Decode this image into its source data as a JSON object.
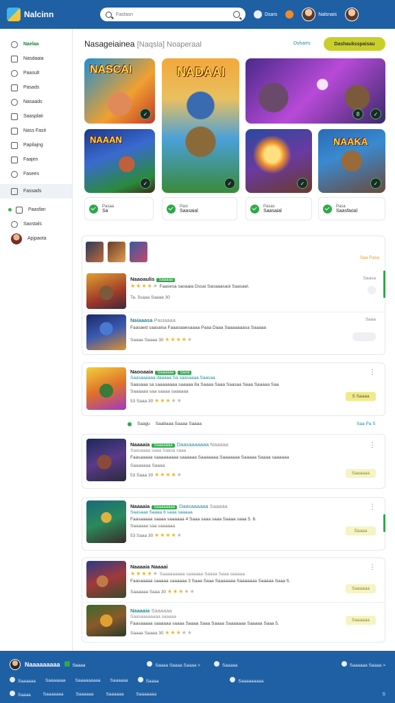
{
  "header": {
    "logo_text": "Nalcinn",
    "search_placeholder": "Fasfasn",
    "item1": "Dsars",
    "item2": "Nalsnais"
  },
  "sidebar": {
    "items": [
      {
        "label": "Naelaa",
        "active": true
      },
      {
        "label": "Nasdaaia"
      },
      {
        "label": "Paasult"
      },
      {
        "label": "Pasads"
      },
      {
        "label": "Nasaads"
      },
      {
        "label": "Saasplati"
      },
      {
        "label": "Nass Fasit"
      },
      {
        "label": "Papilajng"
      },
      {
        "label": "Faajen"
      },
      {
        "label": "Fasees"
      },
      {
        "label": "Fassads"
      },
      {
        "label": "Paasfan"
      },
      {
        "label": "Saostals"
      },
      {
        "label": "Apjpaota"
      }
    ]
  },
  "featured": {
    "heading": "Nasageiainea",
    "heading_sub": "[Naqsla] Noaperaal",
    "see_link": "Dsharrs",
    "cta": "Dashauksspaisau",
    "tiles": [
      {
        "title": "NASCAI"
      },
      {
        "title": "NADAAI"
      },
      {
        "title": ""
      },
      {
        "title": "NAAAN"
      },
      {
        "title": ""
      },
      {
        "title": "NAAKA"
      }
    ],
    "stats": [
      {
        "label": "Pasaa",
        "value": "Sa"
      },
      {
        "label": "Pasi",
        "value": "Saasaial"
      },
      {
        "label": "Pasas",
        "value": "Saasaial"
      },
      {
        "label": "Pasa",
        "value": "Saasfaoal"
      }
    ]
  },
  "list1": {
    "side_link": "Saa Pasa",
    "rows": [
      {
        "title": "Naaoaulis",
        "tag": "Saaaaa",
        "desc": "Faasesa saoaaia Dssai Saoaaasaoi Saasael.",
        "meta": "Ta. 5saaa  Saaaa  30",
        "right": "Saasa"
      },
      {
        "title": "Naiaaasa",
        "sub": "Pasiaaaa",
        "desc": "Faasaed saasaisa Faaasaaesaaaa Paaa Daaa Saaaaaaasa Saaaaa",
        "meta": "Saaaa  Saaaa  30",
        "right": "Saaa"
      }
    ]
  },
  "row3": {
    "title": "Naooaaia",
    "tag": "Saaaaaa",
    "tag2": "Saoa",
    "desc": "Saasaaaaaa daaaaa Sa saasaaaa Saasaa",
    "desc2": "Saasaaa sa saaaaaaaa saaaaa 8a Saaaa Saaa Saasaa Saaa Saaaaa Saa",
    "meta": "Saaaaaa saa saaaa saaaaaa",
    "meta2": "53  Saaa  30",
    "pill": "S Saaaa"
  },
  "midbar": {
    "a": "Saagu",
    "b": "Saabaaa Saaaa Saaaa",
    "see_all": "Saa Pa S"
  },
  "row4": {
    "title": "Naaaaia",
    "tag": "Saaaaaaa",
    "link": "Daasaaaaaaa",
    "sub": "Naaaaa",
    "desc": "Saasaaaa saaa  Saasa saaa",
    "desc2": "Faasaaaaa saaaaaaaaa saaaaaa Saaaaaaa Saaaaaaa Saaaaa Saaaa saaaaaa",
    "meta": "Saaaaaaa Saaaa",
    "meta2": "53  Saaa  30",
    "pill": "Saaaaaa"
  },
  "row5": {
    "title": "Naaaaia",
    "tag": "Saaaaaaaa",
    "link": "Daasaaaaaa",
    "sub": "Saaaaa",
    "desc": "Saasaaa Saaaa 6 saaa saaaaa",
    "desc2": "Faasaaaaa saaaa saaaaaa 4 Saaa saaa saaa Saaaa saaa 5. 6.",
    "meta": "Saaaaaa saa saaaaaa",
    "meta2": "53  Saaa  30",
    "pill": "Saaaa"
  },
  "row6": {
    "title": "Naaaaia",
    "tag": "Naaaai",
    "desc": "Saaaaaaaaa saaaaaa Saaaa Saaa saaaaa",
    "desc2": "Faasaaaaa saaaaa saaaaaa 3 Saaa Saaa Saaaaaaa Saaaaaaa Saaaaa Saaa 5.",
    "meta": "Saaaaaa  Saaa  30",
    "pill": "Saaaaaa"
  },
  "row7": {
    "title": "Naaaaia",
    "sub": "Saaaaaa",
    "desc": "Saasaaaaaaaa saaaaa",
    "desc2": "Faasaaaaa saaaaaa saaaa Saaaa Saaa Saaaa Saaaaaaa Saaaaa Saaa 5.",
    "meta": "Saaaa  Saaaa  30",
    "pill": "Saaaaaa"
  },
  "footer": {
    "name": "Naaaaaaaaa",
    "badge": "Saaaa",
    "link1": "Saaaa Saaaa Saaaa >",
    "link2": "Saaaaa",
    "link3": "Saaaaaa Saaaa >",
    "nav": [
      "Saaaaaa",
      "Saaaaaaa",
      "Saaaaaaaaa",
      "Saaaaaa",
      "Saaaa",
      "Saaaaaaaaa"
    ],
    "bottom": [
      "Saaaa",
      "Saaaaaaa",
      "Saaaaaa",
      "Saaaaaa",
      "Saaaaaaa"
    ],
    "bottom_right": "S"
  },
  "colors": {
    "brand_blue": "#1f5fa4",
    "accent_green": "#2ea84a",
    "cta_yellow": "#c9cf2a"
  },
  "icons": [
    "search-icon",
    "bell-icon",
    "user-avatar",
    "check-icon",
    "kebab-icon"
  ]
}
